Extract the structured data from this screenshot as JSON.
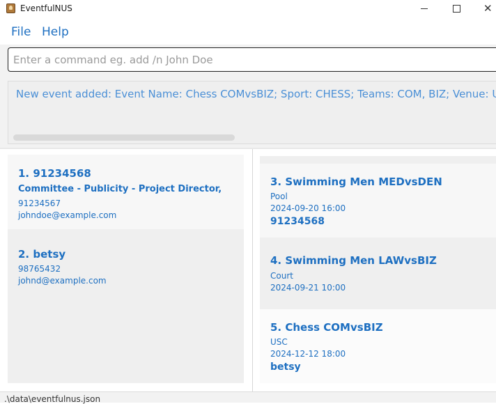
{
  "window": {
    "title": "EventfulNUS",
    "icon": "app-icon"
  },
  "menu": {
    "items": [
      {
        "label": "File"
      },
      {
        "label": "Help"
      }
    ]
  },
  "command": {
    "value": "",
    "placeholder": "Enter a command eg. add /n John Doe"
  },
  "result": {
    "text": "New event added: Event Name: Chess COMvsBIZ; Sport: CHESS; Teams: COM, BIZ; Venue: USC"
  },
  "persons": [
    {
      "index_name": "1. 91234568",
      "role": "Committee - Publicity - Project Director,",
      "phone": "91234567",
      "email": "johndoe@example.com"
    },
    {
      "index_name": "2. betsy",
      "phone": "98765432",
      "email": "johnd@example.com"
    }
  ],
  "events": [
    {
      "index_name": "3. Swimming Men MEDvsDEN",
      "venue": "Pool",
      "datetime": "2024-09-20 16:00",
      "participant": "91234568"
    },
    {
      "index_name": "4. Swimming Men LAWvsBIZ",
      "venue": "Court",
      "datetime": "2024-09-21 10:00"
    },
    {
      "index_name": "5. Chess COMvsBIZ",
      "venue": "USC",
      "datetime": "2024-12-12 18:00",
      "participant": "betsy"
    }
  ],
  "status": {
    "path": ".\\data\\eventfulnus.json"
  },
  "colors": {
    "accent": "#1d6fc1",
    "result_text": "#4a8fd6"
  }
}
